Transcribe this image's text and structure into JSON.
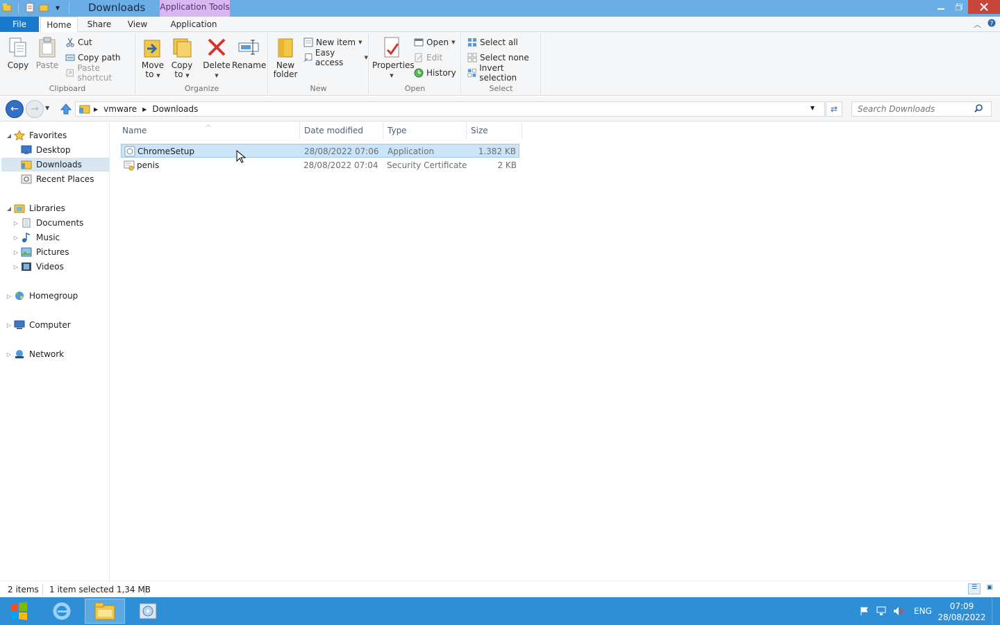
{
  "window": {
    "title": "Downloads",
    "context_tab": "Application Tools",
    "controls": [
      "minimize-icon",
      "restore-icon",
      "close-icon"
    ]
  },
  "tabs": {
    "file": "File",
    "home": "Home",
    "share": "Share",
    "view": "View",
    "application": "Application"
  },
  "ribbon": {
    "clipboard": {
      "label": "Clipboard",
      "copy": "Copy",
      "paste": "Paste",
      "cut": "Cut",
      "copy_path": "Copy path",
      "paste_shortcut": "Paste shortcut"
    },
    "organize": {
      "label": "Organize",
      "move_to_1": "Move",
      "move_to_2": "to",
      "copy_to_1": "Copy",
      "copy_to_2": "to",
      "delete": "Delete",
      "rename": "Rename"
    },
    "new": {
      "label": "New",
      "new_folder_1": "New",
      "new_folder_2": "folder",
      "new_item": "New item",
      "easy_access": "Easy access"
    },
    "open": {
      "label": "Open",
      "properties": "Properties",
      "open": "Open",
      "edit": "Edit",
      "history": "History"
    },
    "select": {
      "label": "Select",
      "select_all": "Select all",
      "select_none": "Select none",
      "invert_selection": "Invert selection"
    }
  },
  "address": {
    "crumbs": [
      "vmware",
      "Downloads"
    ],
    "search_placeholder": "Search Downloads"
  },
  "navpane": {
    "favorites": "Favorites",
    "desktop": "Desktop",
    "downloads": "Downloads",
    "recent_places": "Recent Places",
    "libraries": "Libraries",
    "documents": "Documents",
    "music": "Music",
    "pictures": "Pictures",
    "videos": "Videos",
    "homegroup": "Homegroup",
    "computer": "Computer",
    "network": "Network"
  },
  "columns": {
    "name": "Name",
    "date": "Date modified",
    "type": "Type",
    "size": "Size"
  },
  "files": [
    {
      "name": "ChromeSetup",
      "date": "28/08/2022 07:06",
      "type": "Application",
      "size": "1.382 KB",
      "selected": true
    },
    {
      "name": "penis",
      "date": "28/08/2022 07:04",
      "type": "Security Certificate",
      "size": "2 KB",
      "selected": false
    }
  ],
  "status": {
    "items": "2 items",
    "selection": "1 item selected  1,34 MB"
  },
  "taskbar": {
    "language": "ENG",
    "time": "07:09",
    "date": "28/08/2022"
  }
}
